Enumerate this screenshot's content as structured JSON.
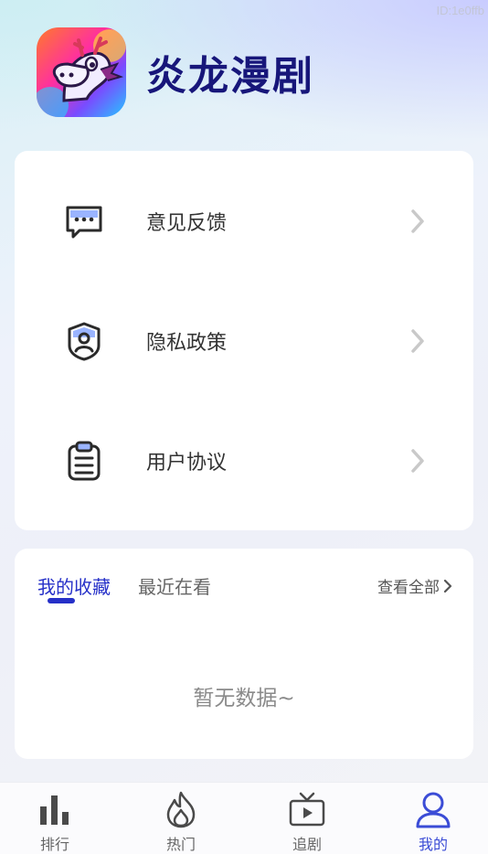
{
  "watermark": "ID:1e0ffb",
  "app": {
    "name": "炎龙漫剧"
  },
  "menu": {
    "items": [
      {
        "label": "意见反馈",
        "icon": "feedback-message-icon"
      },
      {
        "label": "隐私政策",
        "icon": "privacy-shield-icon"
      },
      {
        "label": "用户协议",
        "icon": "clipboard-agreement-icon"
      }
    ]
  },
  "collection": {
    "tabs": [
      {
        "label": "我的收藏",
        "active": true
      },
      {
        "label": "最近在看",
        "active": false
      }
    ],
    "view_all": "查看全部",
    "empty_text": "暂无数据~"
  },
  "bottom_nav": {
    "items": [
      {
        "label": "排行",
        "icon": "bar-chart-icon",
        "active": false
      },
      {
        "label": "热门",
        "icon": "flame-icon",
        "active": false
      },
      {
        "label": "追剧",
        "icon": "tv-play-icon",
        "active": false
      },
      {
        "label": "我的",
        "icon": "user-profile-icon",
        "active": true
      }
    ]
  },
  "colors": {
    "accent": "#2630c8",
    "title": "#17167a",
    "card": "#ffffff"
  }
}
